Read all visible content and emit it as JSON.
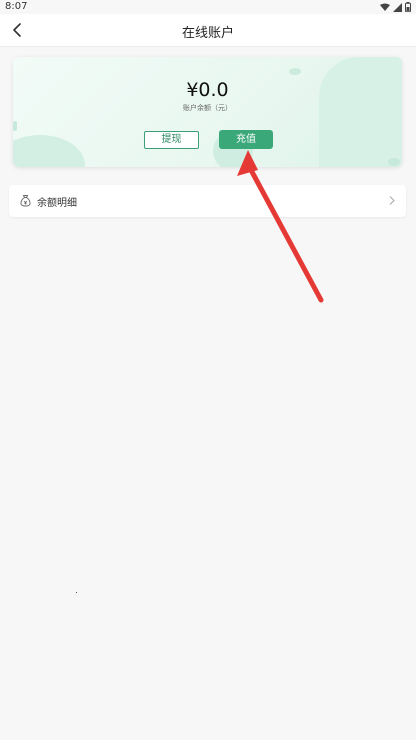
{
  "status_bar": {
    "time": "8:07"
  },
  "header": {
    "title": "在线账户"
  },
  "balance_card": {
    "amount": "¥0.0",
    "label": "账户余额（元）",
    "withdraw_label": "提现",
    "recharge_label": "充值"
  },
  "list": {
    "balance_detail_label": "余额明细"
  },
  "colors": {
    "accent": "#3aa878",
    "annotation_arrow": "#e53935"
  }
}
